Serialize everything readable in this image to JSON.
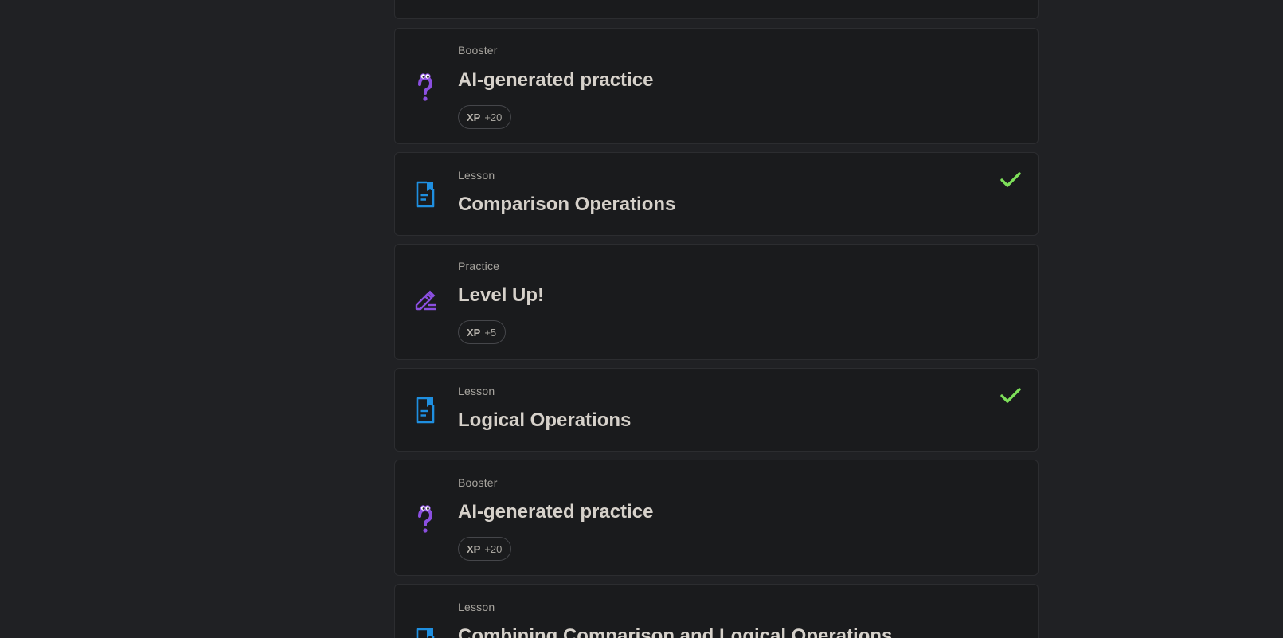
{
  "items": [
    {
      "kind": "",
      "title": ""
    },
    {
      "kind": "Booster",
      "title": "AI-generated practice",
      "xp_label": "XP",
      "xp_points": "+20",
      "icon": "booster-question-icon"
    },
    {
      "kind": "Lesson",
      "title": "Comparison Operations",
      "completed": true,
      "icon": "lesson-document-icon"
    },
    {
      "kind": "Practice",
      "title": "Level Up!",
      "xp_label": "XP",
      "xp_points": "+5",
      "icon": "practice-pencil-icon"
    },
    {
      "kind": "Lesson",
      "title": "Logical Operations",
      "completed": true,
      "icon": "lesson-document-icon"
    },
    {
      "kind": "Booster",
      "title": "AI-generated practice",
      "xp_label": "XP",
      "xp_points": "+20",
      "icon": "booster-question-icon"
    },
    {
      "kind": "Lesson",
      "title": "Combining Comparison and Logical Operations",
      "icon": "lesson-document-icon"
    }
  ],
  "colors": {
    "background": "#202124",
    "card": "#1a1b1d",
    "lesson_icon": "#1f8fe0",
    "booster_icon": "#8b4fe0",
    "check": "#7ee05a"
  }
}
